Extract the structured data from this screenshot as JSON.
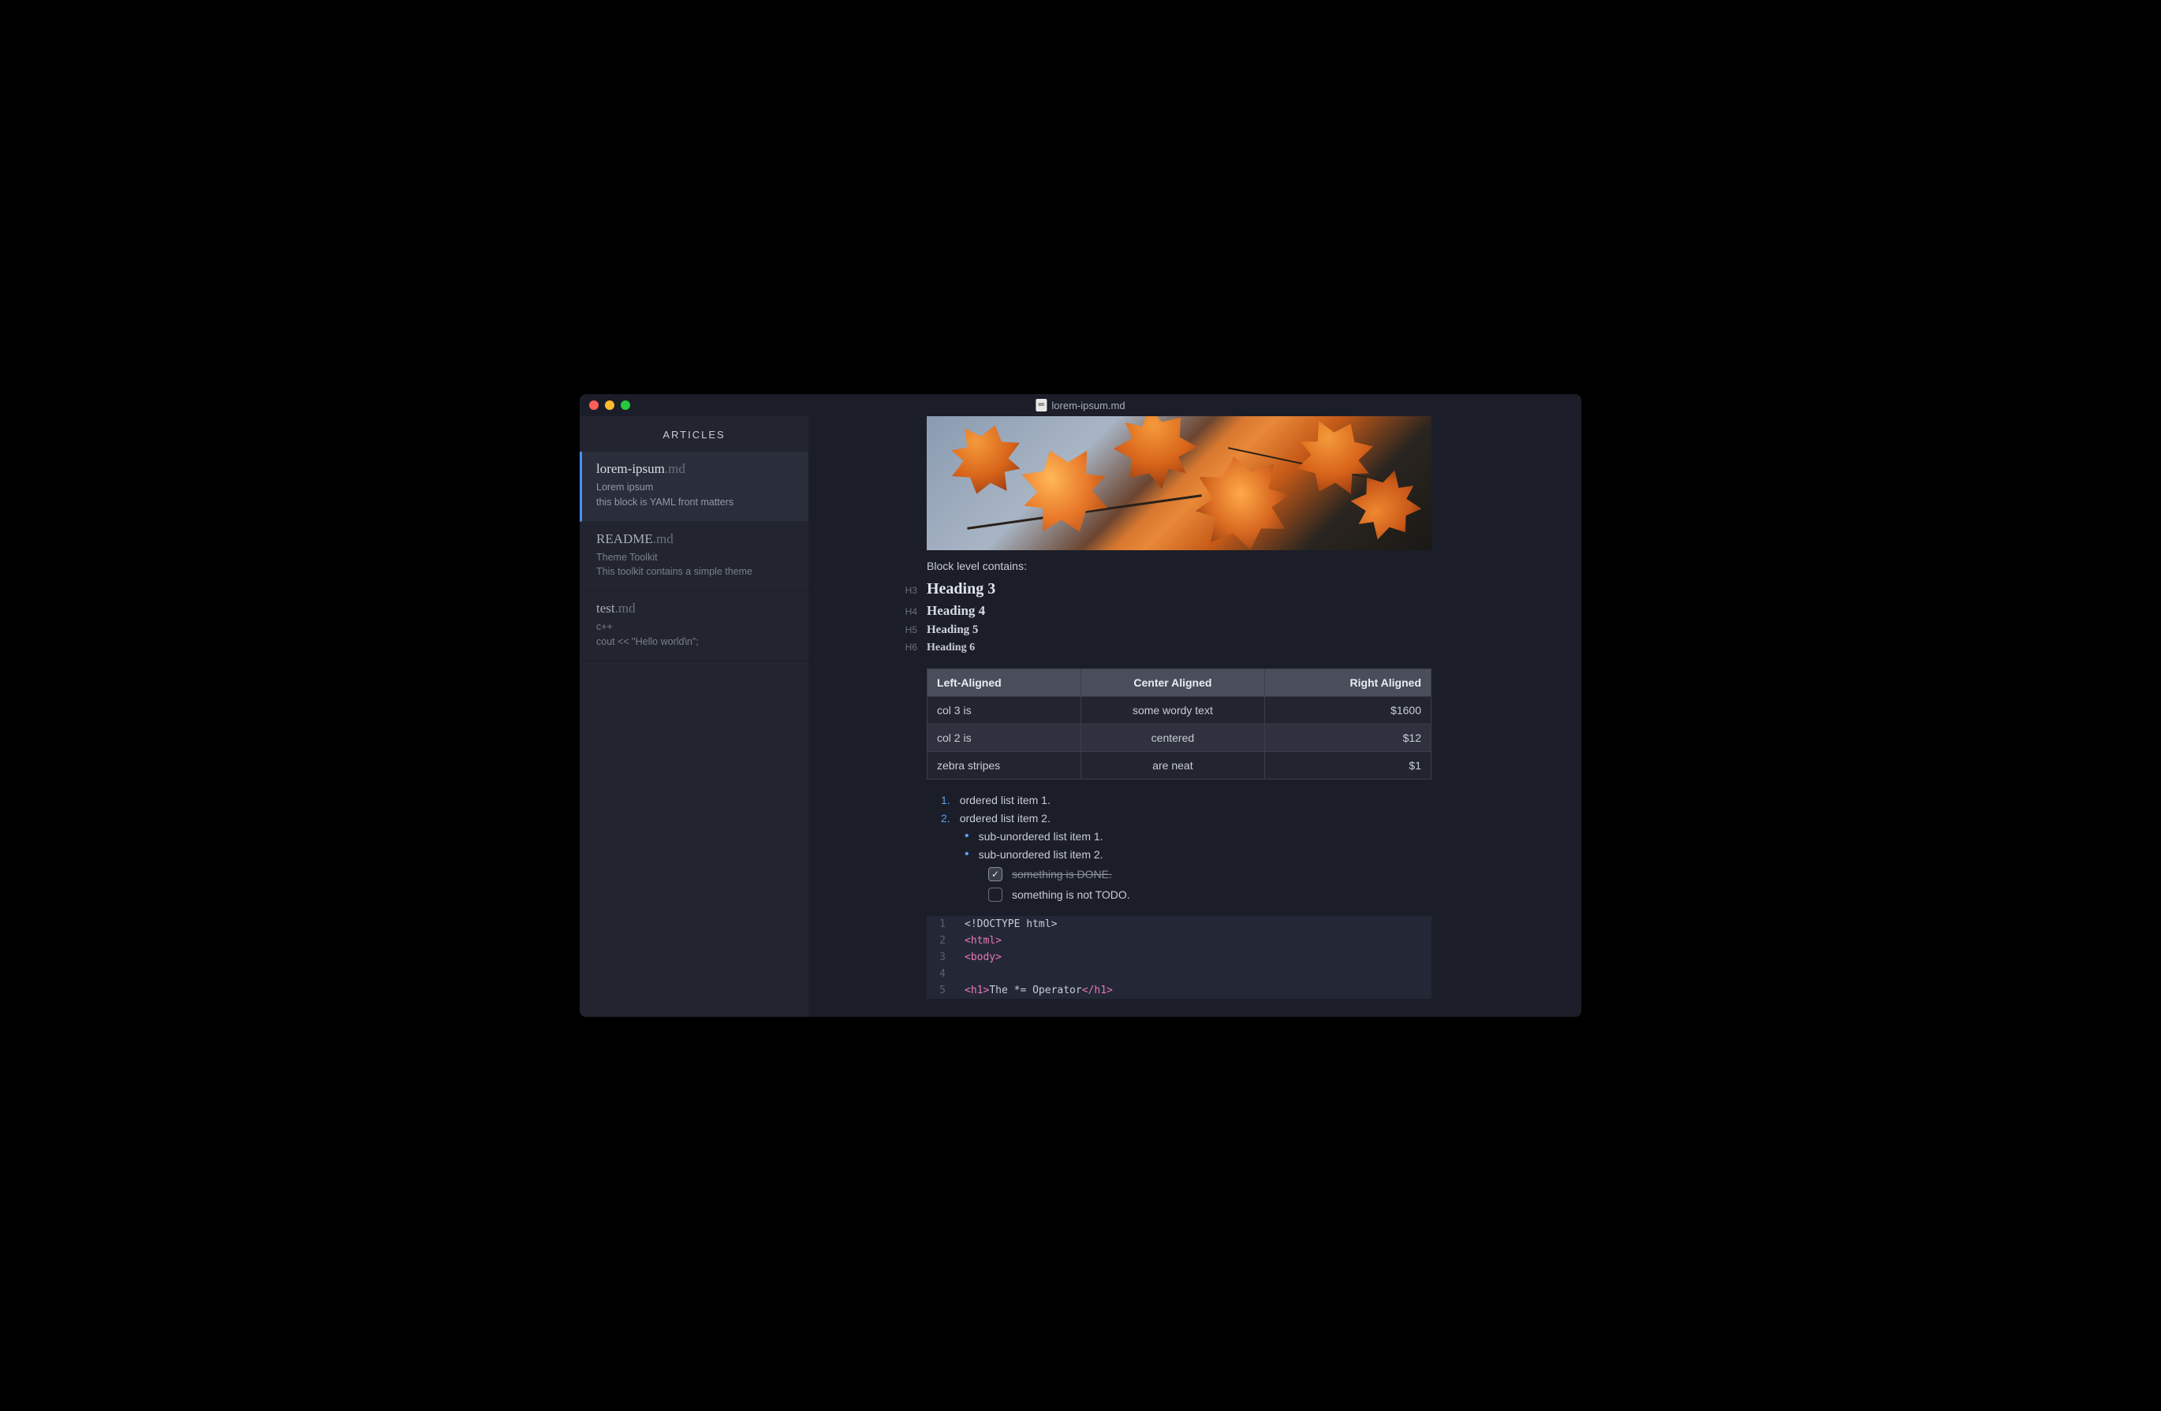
{
  "titlebar": {
    "filename": "lorem-ipsum.md"
  },
  "sidebar": {
    "header": "ARTICLES",
    "items": [
      {
        "name": "lorem-ipsum",
        "ext": ".md",
        "line1": "Lorem ipsum",
        "line2": "this block is YAML front matters",
        "active": true
      },
      {
        "name": "README",
        "ext": ".md",
        "line1": "Theme Toolkit",
        "line2": "This toolkit contains a simple theme",
        "active": false
      },
      {
        "name": "test",
        "ext": ".md",
        "line1": "c++",
        "line2": "cout << \"Hello world\\n\";",
        "active": false
      }
    ]
  },
  "content": {
    "intro": "Block level contains:",
    "headings": [
      {
        "marker": "H3",
        "text": "Heading 3",
        "cls": "h3"
      },
      {
        "marker": "H4",
        "text": "Heading 4",
        "cls": "h4"
      },
      {
        "marker": "H5",
        "text": "Heading 5",
        "cls": "h5"
      },
      {
        "marker": "H6",
        "text": "Heading 6",
        "cls": "h6"
      }
    ],
    "table": {
      "headers": [
        "Left-Aligned",
        "Center Aligned",
        "Right Aligned"
      ],
      "rows": [
        [
          "col 3 is",
          "some wordy text",
          "$1600"
        ],
        [
          "col 2 is",
          "centered",
          "$12"
        ],
        [
          "zebra stripes",
          "are neat",
          "$1"
        ]
      ]
    },
    "olist": [
      {
        "num": "1.",
        "text": "ordered list item 1."
      },
      {
        "num": "2.",
        "text": "ordered list item 2."
      }
    ],
    "sublist": [
      "sub-unordered list item 1.",
      "sub-unordered list item 2."
    ],
    "tasks": [
      {
        "checked": true,
        "text": "something is DONE."
      },
      {
        "checked": false,
        "text": "something is not TODO."
      }
    ],
    "code": {
      "lines": [
        {
          "n": "1",
          "html": "<span class='doctype'>&lt;!DOCTYPE html&gt;</span>"
        },
        {
          "n": "2",
          "html": "<span class='tag'>&lt;html&gt;</span>"
        },
        {
          "n": "3",
          "html": "<span class='tag'>&lt;body&gt;</span>"
        },
        {
          "n": "4",
          "html": ""
        },
        {
          "n": "5",
          "html": "<span class='tag'>&lt;h1&gt;</span>The *= Operator<span class='tag'>&lt;/h1&gt;</span>"
        }
      ]
    }
  }
}
